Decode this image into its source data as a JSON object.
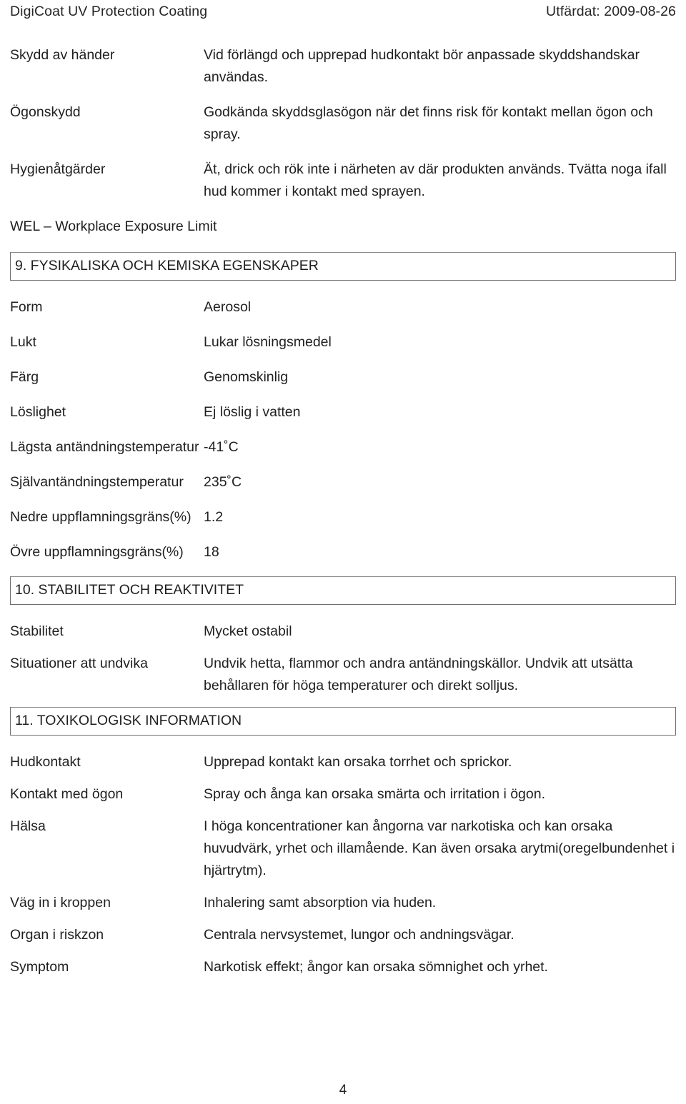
{
  "header": {
    "product_title": "DigiCoat UV Protection Coating",
    "issued": "Utfärdat: 2009-08-26"
  },
  "top_rows": [
    {
      "label": "Skydd av händer",
      "value": "Vid förlängd och upprepad hudkontakt bör anpassade skyddshandskar användas."
    },
    {
      "label": "Ögonskydd",
      "value": "Godkända skyddsglasögon när det finns risk för kontakt mellan ögon och spray."
    },
    {
      "label": "Hygienåtgärder",
      "value": "Ät, drick och rök inte i närheten av där produkten används. Tvätta noga ifall hud kommer i kontakt med sprayen."
    }
  ],
  "wel_note": "WEL – Workplace Exposure Limit",
  "section9": {
    "heading": "9. FYSIKALISKA OCH KEMISKA EGENSKAPER",
    "rows": [
      {
        "label": "Form",
        "value": "Aerosol"
      },
      {
        "label": "Lukt",
        "value": "Lukar lösningsmedel"
      },
      {
        "label": "Färg",
        "value": "Genomskinlig"
      },
      {
        "label": "Löslighet",
        "value": "Ej löslig i vatten"
      },
      {
        "label": "Lägsta antändningstemperatur",
        "value": "-41˚C"
      },
      {
        "label": "Självantändningstemperatur",
        "value": "235˚C"
      },
      {
        "label": "Nedre uppflamningsgräns(%)",
        "value": "1.2"
      },
      {
        "label": "Övre uppflamningsgräns(%)",
        "value": "18"
      }
    ]
  },
  "section10": {
    "heading": "10. STABILITET OCH REAKTIVITET",
    "rows": [
      {
        "label": "Stabilitet",
        "value": "Mycket ostabil"
      },
      {
        "label": "Situationer att undvika",
        "value": "Undvik hetta, flammor och andra antändningskällor. Undvik att utsätta behållaren för höga temperaturer och direkt solljus."
      }
    ]
  },
  "section11": {
    "heading": "11. TOXIKOLOGISK INFORMATION",
    "rows": [
      {
        "label": "Hudkontakt",
        "value": "Upprepad kontakt kan orsaka torrhet och sprickor."
      },
      {
        "label": "Kontakt med ögon",
        "value": "Spray och ånga kan orsaka smärta och irritation i ögon."
      },
      {
        "label": "Hälsa",
        "value": "I höga koncentrationer kan ångorna var narkotiska och kan orsaka huvudvärk, yrhet och illamående. Kan även orsaka arytmi(oregelbundenhet i hjärtrytm)."
      },
      {
        "label": "Väg in i kroppen",
        "value": "Inhalering samt absorption via huden."
      },
      {
        "label": "Organ i riskzon",
        "value": "Centrala nervsystemet, lungor och andningsvägar."
      },
      {
        "label": "Symptom",
        "value": "Narkotisk effekt; ångor kan orsaka sömnighet och yrhet."
      }
    ]
  },
  "footer": {
    "page_number": "4"
  }
}
